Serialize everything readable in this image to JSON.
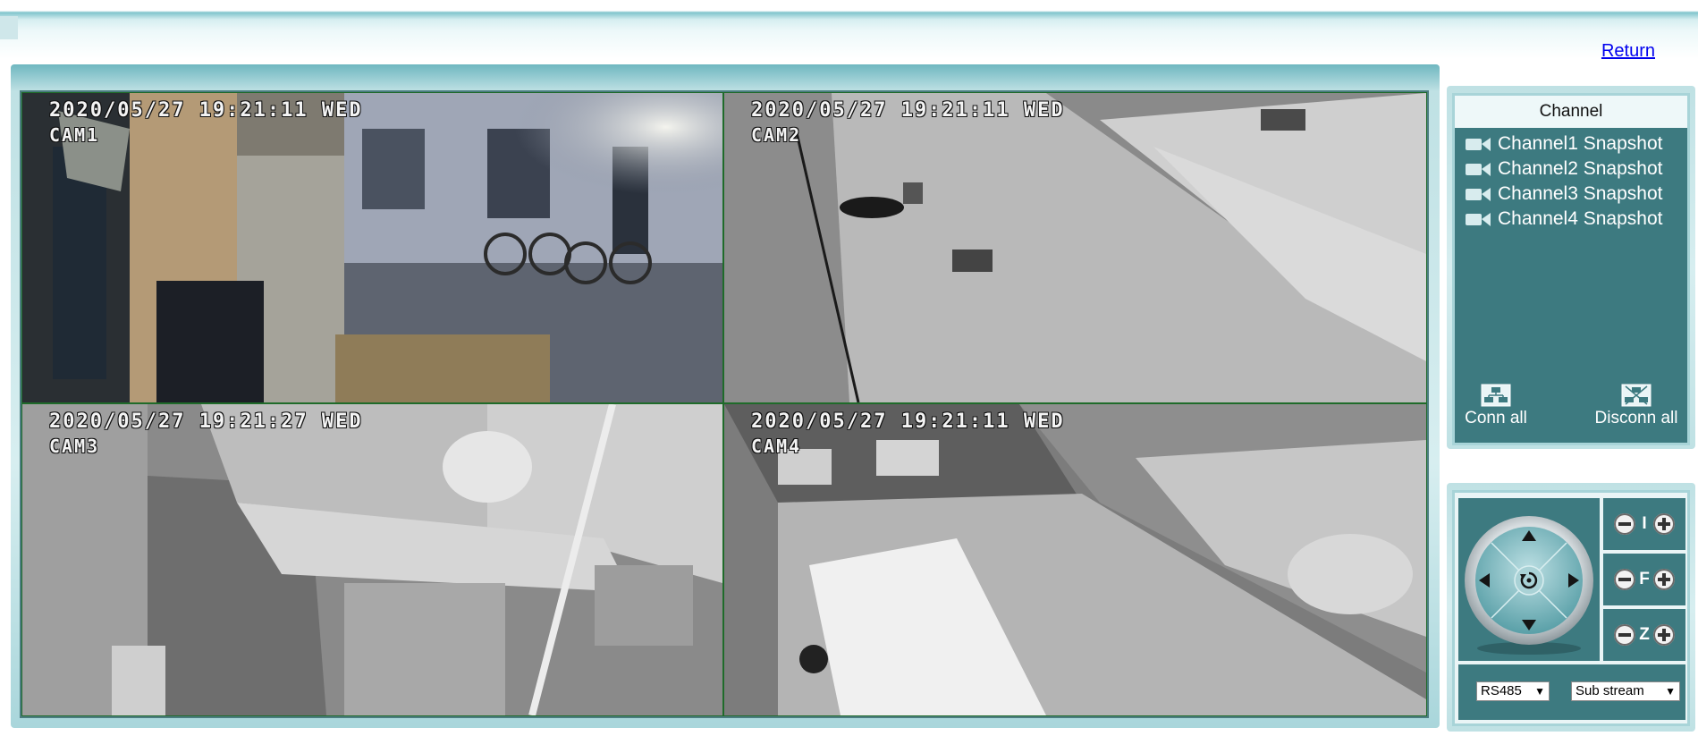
{
  "header": {
    "return_label": "Return"
  },
  "cameras": [
    {
      "timestamp": "2020/05/27  19:21:11  WED",
      "name": "CAM1"
    },
    {
      "timestamp": "2020/05/27  19:21:11  WED",
      "name": "CAM2"
    },
    {
      "timestamp": "2020/05/27  19:21:27  WED",
      "name": "CAM3"
    },
    {
      "timestamp": "2020/05/27  19:21:11  WED",
      "name": "CAM4"
    }
  ],
  "channel_panel": {
    "title": "Channel",
    "items": [
      {
        "label": "Channel1 Snapshot",
        "icon": "camera-icon"
      },
      {
        "label": "Channel2 Snapshot",
        "icon": "camera-icon"
      },
      {
        "label": "Channel3 Snapshot",
        "icon": "camera-icon"
      },
      {
        "label": "Channel4 Snapshot",
        "icon": "camera-icon"
      }
    ],
    "conn_all_label": "Conn all",
    "disconn_all_label": "Disconn all"
  },
  "ptz": {
    "iris_label": "I",
    "focus_label": "F",
    "zoom_label": "Z",
    "protocol_value": "RS485",
    "stream_value": "Sub stream"
  },
  "colors": {
    "panel_teal": "#3d7a80",
    "frame_light": "#d7eef0",
    "link": "#0000ee"
  }
}
